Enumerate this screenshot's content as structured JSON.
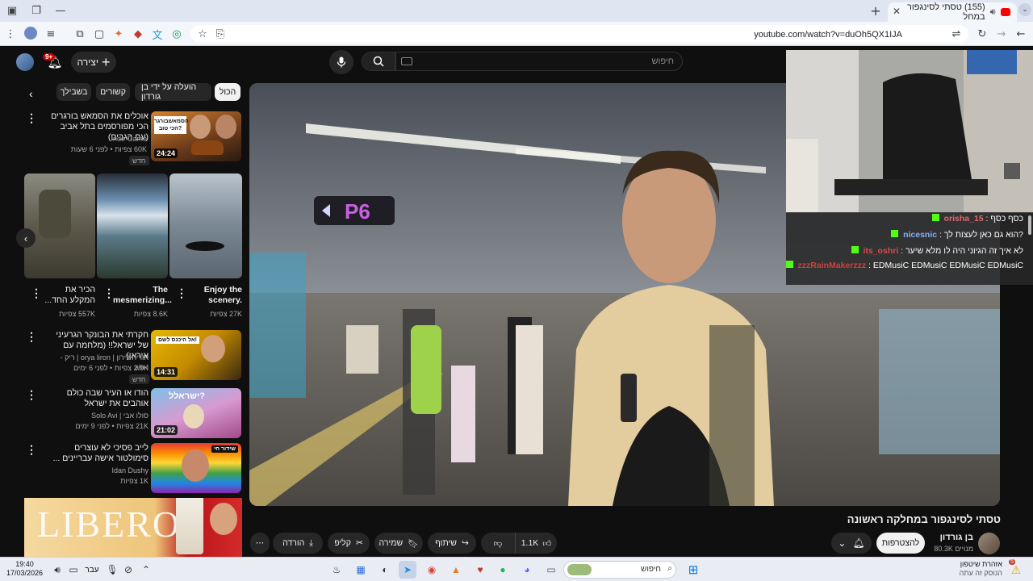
{
  "browser": {
    "tab_title": "(155) טסתי לסינגפור במחל",
    "url": "youtube.com/watch?v=duOh5QX1IJA",
    "tab_badge": "YT"
  },
  "header": {
    "create_label": "יצירה",
    "notif_count": "9+",
    "search_placeholder": "חיפוש"
  },
  "chips": [
    "הכול",
    "הועלה על ידי בן גורדון",
    "קשורים",
    "בשבילך"
  ],
  "recommendations": [
    {
      "title": "אוכלים את הסמאש בורגרים הכי מפורסמים בתל אביב (עם הגבים)",
      "channel": "Inde Game",
      "meta": "60K צפיות • לפני 6 שעות",
      "badge": "חדש",
      "duration": "24:24",
      "thumb_text": "הסמאשבורגר הכי טוב?"
    },
    {
      "title": "חקרתי את הבונקר הגרעיני של ישראל!! (מלחמה עם איראן)",
      "channel": "אוריה לירון | orya liron | ריק - aln-i",
      "meta": "2.9K צפיות • לפני 6 ימים",
      "badge": "חדש",
      "duration": "14:31",
      "thumb_text": "אל היכנס לשם!"
    },
    {
      "title": "הודו או העיר שבה כולם אוהבים את ישראל",
      "channel": "סולו אבי | Solo Avi",
      "meta": "21K צפיות • לפני 9 ימים",
      "badge": "",
      "duration": "21:02",
      "thumb_text": "ישראלל?"
    },
    {
      "title": "לייב פסיכי לא עוצרים סימולטור אישה עבריינים ...",
      "channel": "Idan Dushy",
      "meta": "1K צפיות",
      "badge": "",
      "duration": "",
      "thumb_text": "שידור חי"
    }
  ],
  "shorts": [
    {
      "title": "Enjoy the scenery.",
      "views": "27K צפיות"
    },
    {
      "title": "The mesmerizing...",
      "views": "8.6K צפיות"
    },
    {
      "title": "הכיר את המקלע החד...",
      "views": "557K צפיות"
    }
  ],
  "ad": {
    "brand": "LIBERO"
  },
  "video": {
    "title": "טסתי לסינגפור במחלקה ראשונה",
    "channel_name": "בן גורדון",
    "subscribers": "80.3K מנויים",
    "subscribe_label": "להצטרפות",
    "like_count": "1.1K",
    "share_label": "שיתוף",
    "save_label": "שמירה",
    "clip_label": "קליפ",
    "download_label": "הורדה",
    "gate_sign": "P6"
  },
  "chat": [
    {
      "user": "orisha_15",
      "text": "כסף כסף",
      "color": "#e06a6a"
    },
    {
      "user": "nicesnic",
      "text": "?הוא גם כאן לעצות לך",
      "color": "#7fb3ff"
    },
    {
      "user": "its_oshri",
      "text": "לא איך זה הגיוני היה לו מלא שיער",
      "color": "#e04a4a"
    },
    {
      "user": "zzzRainMakerzzz",
      "text": "EDMusiC EDMusiC EDMusiC EDMusiC",
      "color": "#d04040"
    }
  ],
  "taskbar": {
    "time": "19:40",
    "date": "17/03/2026",
    "lang": "עבר",
    "search_placeholder": "חיפוש",
    "notif_title": "אזהרת שיטפון",
    "notif_sub": "הנוסק זה עתה",
    "notif_badge": "5"
  },
  "colors": {
    "accent_red": "#ff0000",
    "bg": "#0f0f0f",
    "chip": "#272727"
  }
}
